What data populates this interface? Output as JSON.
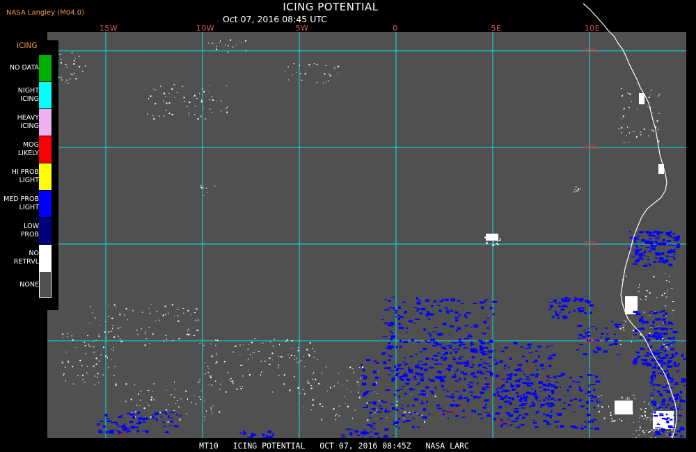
{
  "header": {
    "credit": "NASA Langley (M04.0)",
    "title": "ICING POTENTIAL",
    "subtitle": "Oct 07, 2016 08:45 UTC"
  },
  "map": {
    "lon_labels": [
      "15W",
      "10W",
      "5W",
      "0",
      "5E",
      "10E"
    ],
    "lat_labels": [
      "45N",
      "40N",
      "35N",
      "30N"
    ],
    "colors": {
      "background": "#505050",
      "grid": "#00e8e8",
      "coast": "#ffffff",
      "med_prob_light": "#0000ff",
      "mog_likely": "#ff0000",
      "no_retrvl": "#ffffff"
    }
  },
  "legend": {
    "title": "ICING",
    "items": [
      {
        "label": "NO DATA",
        "color": "#00b000"
      },
      {
        "label": "NIGHT\nICING",
        "color": "#00ffff"
      },
      {
        "label": "HEAVY\nICING",
        "color": "#f0b0f0"
      },
      {
        "label": "MOG\nLIKELY",
        "color": "#ff0000"
      },
      {
        "label": "HI PROB\nLIGHT",
        "color": "#ffff00"
      },
      {
        "label": "MED PROB\nLIGHT",
        "color": "#0000ff"
      },
      {
        "label": "LOW\nPROB",
        "color": "#000080"
      },
      {
        "label": "NO\nRETRVL",
        "color": "#ffffff"
      },
      {
        "label": "NONE",
        "color": "#505050"
      }
    ]
  },
  "footer": {
    "text": "MT10   ICING POTENTIAL   OCT 07, 2016 08:45Z   NASA LARC"
  }
}
